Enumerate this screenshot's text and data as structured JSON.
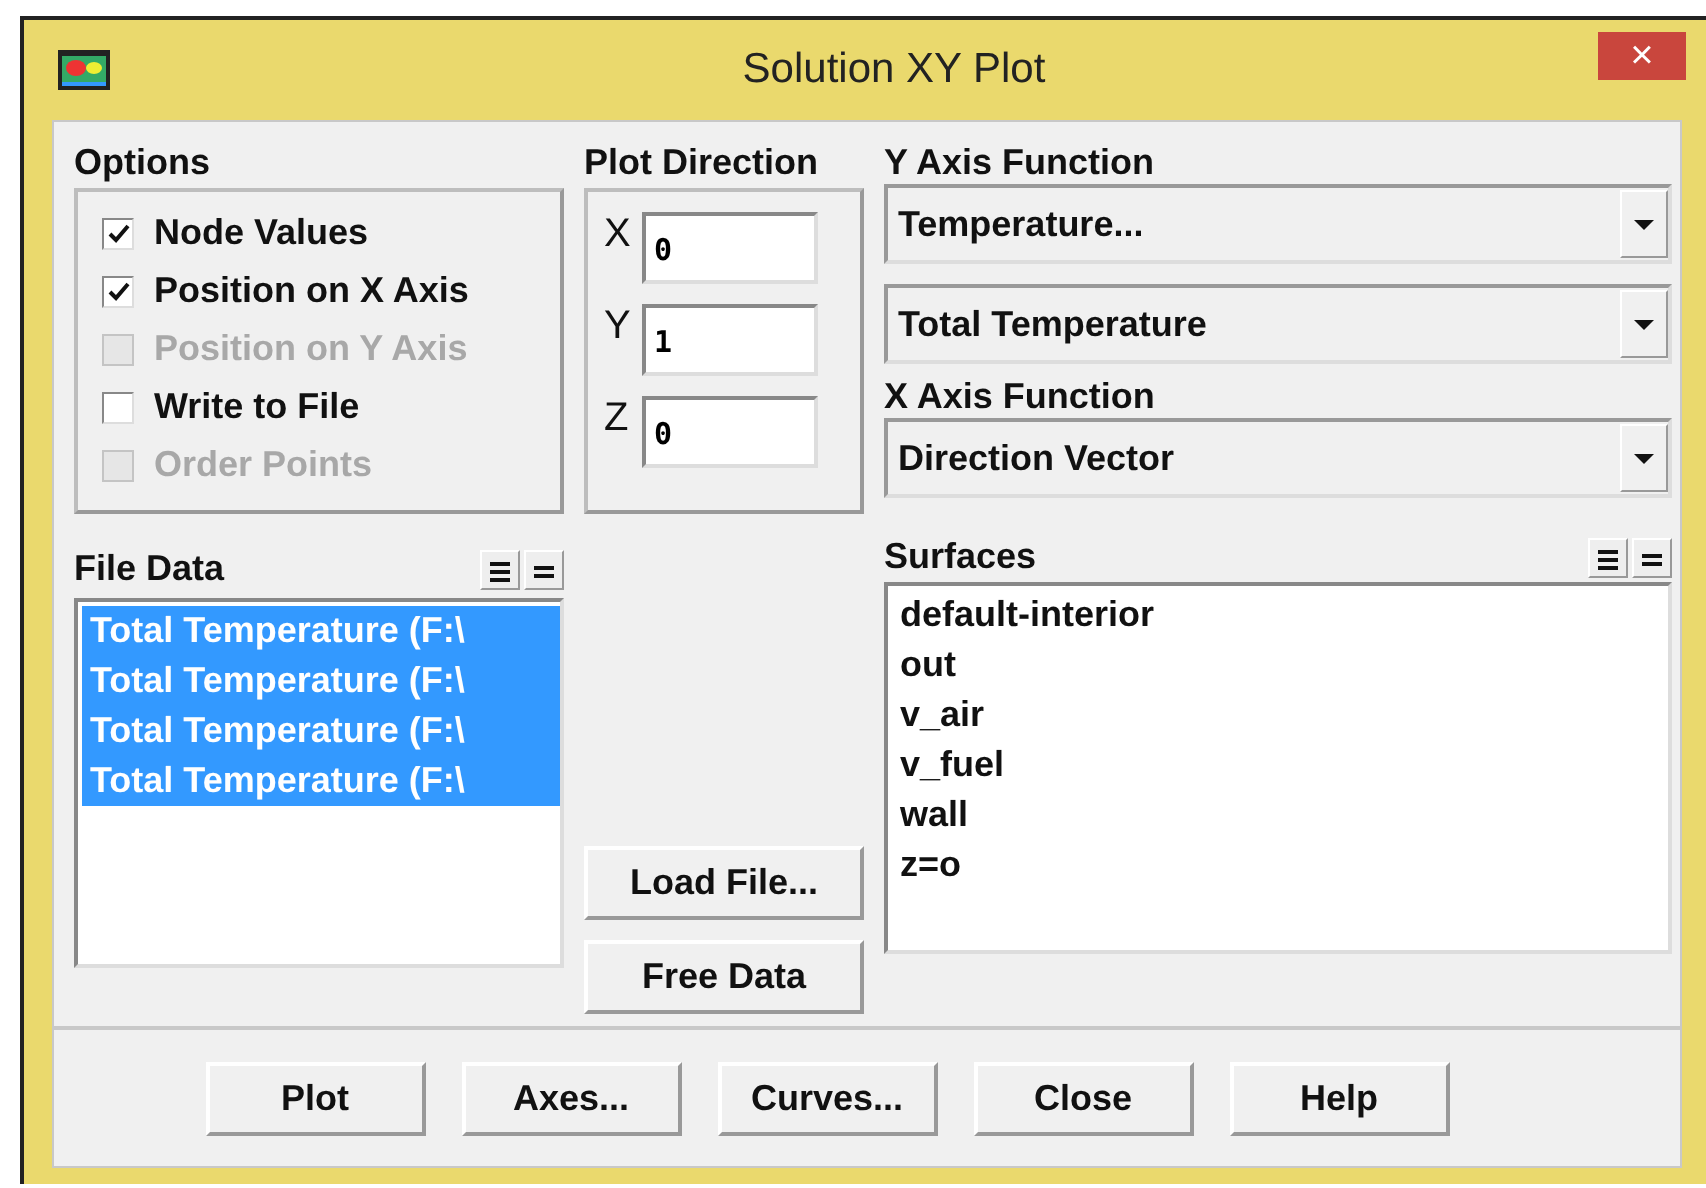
{
  "window": {
    "title": "Solution XY Plot",
    "close": "×"
  },
  "options": {
    "label": "Options",
    "items": [
      {
        "label": "Node Values",
        "checked": true,
        "disabled": false
      },
      {
        "label": "Position on X Axis",
        "checked": true,
        "disabled": false
      },
      {
        "label": "Position on Y Axis",
        "checked": false,
        "disabled": true
      },
      {
        "label": "Write to File",
        "checked": false,
        "disabled": false
      },
      {
        "label": "Order Points",
        "checked": false,
        "disabled": true
      }
    ]
  },
  "plot_direction": {
    "label": "Plot Direction",
    "fields": [
      {
        "axis": "X",
        "value": "0"
      },
      {
        "axis": "Y",
        "value": "1"
      },
      {
        "axis": "Z",
        "value": "0"
      }
    ]
  },
  "y_axis_function": {
    "label": "Y Axis Function",
    "category": "Temperature...",
    "quantity": "Total Temperature"
  },
  "x_axis_function": {
    "label": "X Axis Function",
    "value": "Direction Vector"
  },
  "file_data": {
    "label": "File Data",
    "items": [
      {
        "text": "Total Temperature (F:\\",
        "selected": true
      },
      {
        "text": "Total Temperature (F:\\",
        "selected": true
      },
      {
        "text": "Total Temperature (F:\\",
        "selected": true
      },
      {
        "text": "Total Temperature (F:\\",
        "selected": true
      }
    ]
  },
  "side_buttons": [
    "Load File...",
    "Free Data"
  ],
  "surfaces": {
    "label": "Surfaces",
    "items": [
      {
        "text": "default-interior",
        "selected": false
      },
      {
        "text": "out",
        "selected": false
      },
      {
        "text": "v_air",
        "selected": false
      },
      {
        "text": "v_fuel",
        "selected": false
      },
      {
        "text": "wall",
        "selected": false
      },
      {
        "text": "z=o",
        "selected": false
      }
    ]
  },
  "buttons": [
    "Plot",
    "Axes...",
    "Curves...",
    "Close",
    "Help"
  ]
}
